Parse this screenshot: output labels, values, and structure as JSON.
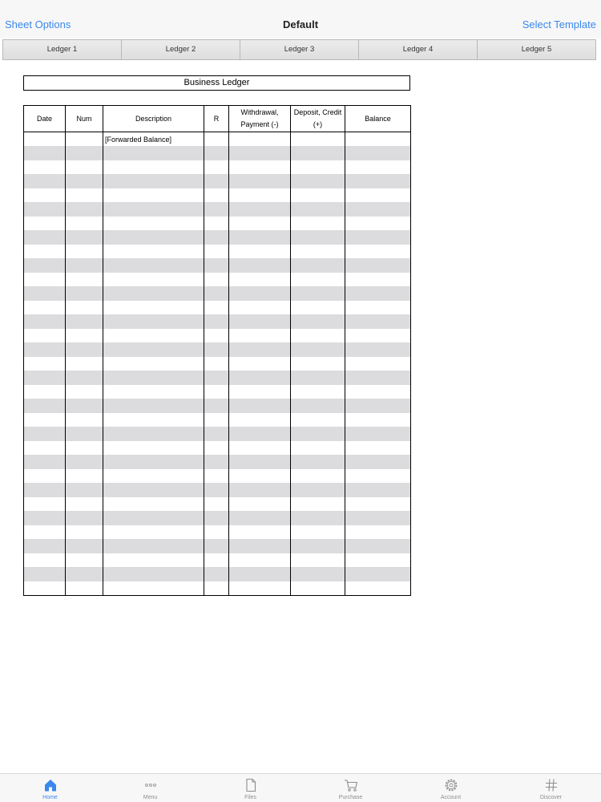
{
  "nav": {
    "left_label": "Sheet Options",
    "title": "Default",
    "right_label": "Select Template"
  },
  "tabs": [
    {
      "label": "Ledger 1"
    },
    {
      "label": "Ledger 2"
    },
    {
      "label": "Ledger 3"
    },
    {
      "label": "Ledger 4"
    },
    {
      "label": "Ledger 5"
    }
  ],
  "sheet": {
    "title": "Business Ledger",
    "columns": {
      "date": "Date",
      "num": "Num",
      "description": "Description",
      "r": "R",
      "withdrawal": "Withdrawal,\nPayment (-)",
      "deposit": "Deposit, Credit\n(+)",
      "balance": "Balance"
    },
    "rows": [
      [
        "",
        "",
        "[Forwarded Balance]",
        "",
        "",
        "",
        ""
      ],
      [
        "",
        "",
        "",
        "",
        "",
        "",
        ""
      ],
      [
        "",
        "",
        "",
        "",
        "",
        "",
        ""
      ],
      [
        "",
        "",
        "",
        "",
        "",
        "",
        ""
      ],
      [
        "",
        "",
        "",
        "",
        "",
        "",
        ""
      ],
      [
        "",
        "",
        "",
        "",
        "",
        "",
        ""
      ],
      [
        "",
        "",
        "",
        "",
        "",
        "",
        ""
      ],
      [
        "",
        "",
        "",
        "",
        "",
        "",
        ""
      ],
      [
        "",
        "",
        "",
        "",
        "",
        "",
        ""
      ],
      [
        "",
        "",
        "",
        "",
        "",
        "",
        ""
      ],
      [
        "",
        "",
        "",
        "",
        "",
        "",
        ""
      ],
      [
        "",
        "",
        "",
        "",
        "",
        "",
        ""
      ],
      [
        "",
        "",
        "",
        "",
        "",
        "",
        ""
      ],
      [
        "",
        "",
        "",
        "",
        "",
        "",
        ""
      ],
      [
        "",
        "",
        "",
        "",
        "",
        "",
        ""
      ],
      [
        "",
        "",
        "",
        "",
        "",
        "",
        ""
      ],
      [
        "",
        "",
        "",
        "",
        "",
        "",
        ""
      ],
      [
        "",
        "",
        "",
        "",
        "",
        "",
        ""
      ],
      [
        "",
        "",
        "",
        "",
        "",
        "",
        ""
      ],
      [
        "",
        "",
        "",
        "",
        "",
        "",
        ""
      ],
      [
        "",
        "",
        "",
        "",
        "",
        "",
        ""
      ],
      [
        "",
        "",
        "",
        "",
        "",
        "",
        ""
      ],
      [
        "",
        "",
        "",
        "",
        "",
        "",
        ""
      ],
      [
        "",
        "",
        "",
        "",
        "",
        "",
        ""
      ],
      [
        "",
        "",
        "",
        "",
        "",
        "",
        ""
      ],
      [
        "",
        "",
        "",
        "",
        "",
        "",
        ""
      ],
      [
        "",
        "",
        "",
        "",
        "",
        "",
        ""
      ],
      [
        "",
        "",
        "",
        "",
        "",
        "",
        ""
      ],
      [
        "",
        "",
        "",
        "",
        "",
        "",
        ""
      ],
      [
        "",
        "",
        "",
        "",
        "",
        "",
        ""
      ],
      [
        "",
        "",
        "",
        "",
        "",
        "",
        ""
      ],
      [
        "",
        "",
        "",
        "",
        "",
        "",
        ""
      ],
      [
        "",
        "",
        "",
        "",
        "",
        "",
        ""
      ]
    ]
  },
  "tab_bar": {
    "active": "home",
    "items": [
      {
        "id": "home",
        "label": "Home",
        "icon": "home-icon"
      },
      {
        "id": "menu",
        "label": "Menu",
        "icon": "ellipsis-icon"
      },
      {
        "id": "files",
        "label": "Files",
        "icon": "file-icon"
      },
      {
        "id": "purchase",
        "label": "Purchase",
        "icon": "cart-icon"
      },
      {
        "id": "account",
        "label": "Account",
        "icon": "gear-icon"
      },
      {
        "id": "discover",
        "label": "Discover",
        "icon": "hash-icon"
      }
    ]
  },
  "colors": {
    "accent": "#3a88ee",
    "inactive": "#8e8e93",
    "stripe": "#dcdcdf"
  }
}
